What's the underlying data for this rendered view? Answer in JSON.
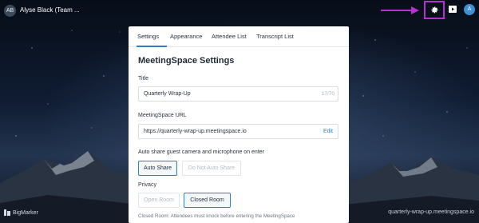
{
  "header": {
    "host_initials": "AB",
    "host_name": "Alyse Black (Team ...",
    "user_initial": "A"
  },
  "tabs": [
    {
      "label": "Settings",
      "active": true
    },
    {
      "label": "Appearance",
      "active": false
    },
    {
      "label": "Attendee List",
      "active": false
    },
    {
      "label": "Transcript List",
      "active": false
    }
  ],
  "settings": {
    "heading": "MeetingSpace Settings",
    "title_label": "Title",
    "title_value": "Quarterly Wrap-Up",
    "title_count": "17/70",
    "url_label": "MeetingSpace URL",
    "url_value": "https://quarterly-wrap-up.meetingspace.io",
    "url_edit": "Edit",
    "autoshare_label": "Auto share guest camera and microphone on enter",
    "autoshare_on": "Auto Share",
    "autoshare_off": "Do Not Auto Share",
    "privacy_label": "Privacy",
    "privacy_open": "Open Room",
    "privacy_closed": "Closed Room",
    "privacy_note": "Closed Room: Attendees must knock before entering the MeetingSpace"
  },
  "footer": {
    "brand": "BigMarker",
    "url": "quarterly-wrap-up.meetingspace.io"
  },
  "colors": {
    "accent": "#2d7fd0",
    "highlight": "#b630d1",
    "avatar": "#3e8ed8"
  },
  "icons": [
    "settings-gear-icon",
    "video-icon",
    "arrow-right-icon",
    "bigmarker-logo-icon"
  ]
}
